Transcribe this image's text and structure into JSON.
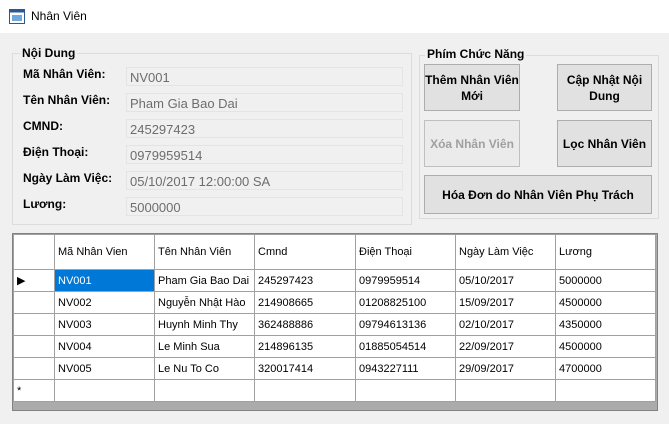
{
  "window": {
    "title": "Nhân Viên"
  },
  "details": {
    "group_title": "Nội Dung",
    "fields": [
      {
        "label": "Mã Nhân Viên:",
        "value": "NV001"
      },
      {
        "label": "Tên Nhân Viên:",
        "value": "Pham Gia Bao Dai"
      },
      {
        "label": "CMND:",
        "value": "245297423"
      },
      {
        "label": "Điện Thoại:",
        "value": "0979959514"
      },
      {
        "label": "Ngày Làm Việc:",
        "value": "05/10/2017 12:00:00 SA"
      },
      {
        "label": "Lương:",
        "value": "5000000"
      }
    ]
  },
  "actions": {
    "group_title": "Phím Chức Năng",
    "add_label": "Thêm Nhân Viên Mới",
    "update_label": "Cập Nhật Nội Dung",
    "delete_label": "Xóa Nhân Viên",
    "filter_label": "Lọc Nhân Viên",
    "invoice_label": "Hóa Đơn do Nhân Viên Phụ Trách"
  },
  "grid": {
    "columns": [
      "Mã Nhân Vien",
      "Tên Nhân Viên",
      "Cmnd",
      "Điện Thoại",
      "Ngày Làm Việc",
      "Lương"
    ],
    "rows": [
      [
        "NV001",
        "Pham Gia Bao Dai",
        "245297423",
        "0979959514",
        "05/10/2017",
        "5000000"
      ],
      [
        "NV002",
        "Nguyễn Nhật Hào",
        "214908665",
        "01208825100",
        "15/09/2017",
        "4500000"
      ],
      [
        "NV003",
        "Huynh Minh Thy",
        "362488886",
        "09794613136",
        "02/10/2017",
        "4350000"
      ],
      [
        "NV004",
        "Le Minh Sua",
        "214896135",
        "01885054514",
        "22/09/2017",
        "4500000"
      ],
      [
        "NV005",
        "Le Nu To Co",
        "320017414",
        "0943227111",
        "29/09/2017",
        "4700000"
      ]
    ],
    "current_row_marker": "▶",
    "new_row_marker": "*"
  }
}
